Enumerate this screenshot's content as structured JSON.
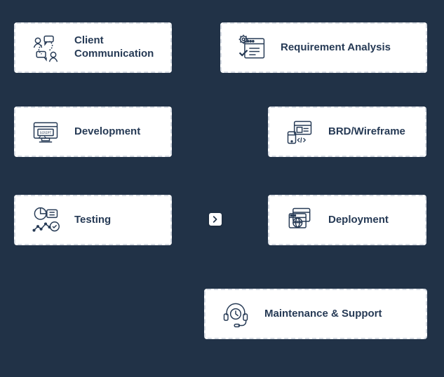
{
  "diagram": {
    "steps": [
      {
        "id": "client-communication",
        "label": "Client\nCommunication",
        "icon": "chat-people"
      },
      {
        "id": "requirement-analysis",
        "label": "Requirement Analysis",
        "icon": "gear-doc"
      },
      {
        "id": "development",
        "label": "Development",
        "icon": "script-monitor"
      },
      {
        "id": "brd-wireframe",
        "label": "BRD/Wireframe",
        "icon": "wireframe-code"
      },
      {
        "id": "testing",
        "label": "Testing",
        "icon": "chart-test"
      },
      {
        "id": "deployment",
        "label": "Deployment",
        "icon": "globe-windows"
      },
      {
        "id": "maintenance-support",
        "label": "Maintenance & Support",
        "icon": "headset-clock"
      }
    ],
    "connector": {
      "direction": "right"
    }
  },
  "colors": {
    "background": "#213247",
    "card_bg": "#ffffff",
    "card_border": "#d6dbe3",
    "text": "#263a55",
    "stroke": "#263a55"
  }
}
